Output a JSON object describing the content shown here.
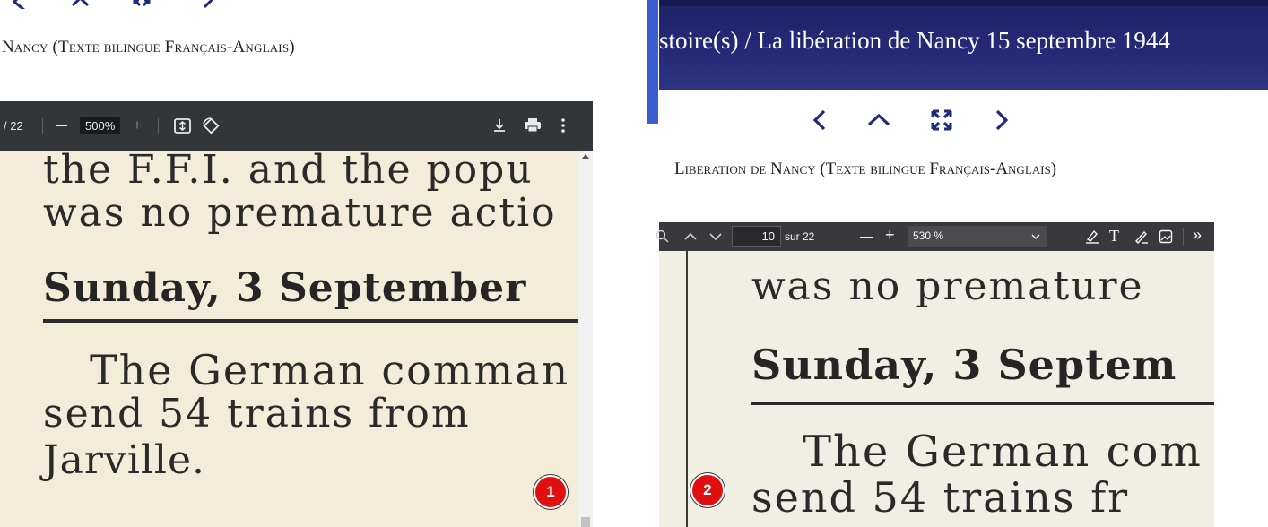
{
  "left": {
    "nav": {
      "prev": "<",
      "close": "×",
      "fullscreen": "⤢",
      "next": ">"
    },
    "document_title": "Nancy (Texte bilingue Français-Anglais)",
    "pdf_toolbar": {
      "page_total": "/ 22",
      "zoom_out": "—",
      "zoom_value": "500%",
      "zoom_in": "+",
      "fit_icon": "fit-page-icon",
      "rotate_icon": "rotate-icon",
      "download_icon": "download-icon",
      "print_icon": "print-icon",
      "more_icon": "more-vert-icon"
    },
    "scan_text": {
      "line1": "the F.F.I. and the popu",
      "line2": "was no premature actio",
      "heading": "Sunday, 3 September",
      "line3": "The German comman",
      "line4": "send 54 trains from",
      "line5": "Jarville."
    },
    "badge": "1"
  },
  "right": {
    "breadcrumb": "stoire(s) / La libération de Nancy 15 septembre 1944",
    "nav": {
      "prev": "<",
      "up": "^",
      "fullscreen": "⤢",
      "next": ">"
    },
    "document_title": "Liberation de Nancy (Texte bilingue Français-Anglais)",
    "pdf_toolbar": {
      "search_icon": "search-icon",
      "prev_page": "^",
      "next_page": "v",
      "page_value": "10",
      "page_of": "sur 22",
      "zoom_out": "—",
      "zoom_in": "+",
      "zoom_value": "530 %",
      "highlight_icon": "highlight-icon",
      "text_icon": "T",
      "draw_icon": "draw-icon",
      "image_icon": "image-icon",
      "more": "»"
    },
    "scan_text": {
      "line1": "was no premature",
      "heading": "Sunday, 3 Septem",
      "line2": "The German com",
      "line3": "send 54 trains fr"
    },
    "badge": "2"
  },
  "colors": {
    "header": "#242a78",
    "nav_icon": "#1e2a7a",
    "badge": "#e01010",
    "divider": "#3a5ed0"
  }
}
